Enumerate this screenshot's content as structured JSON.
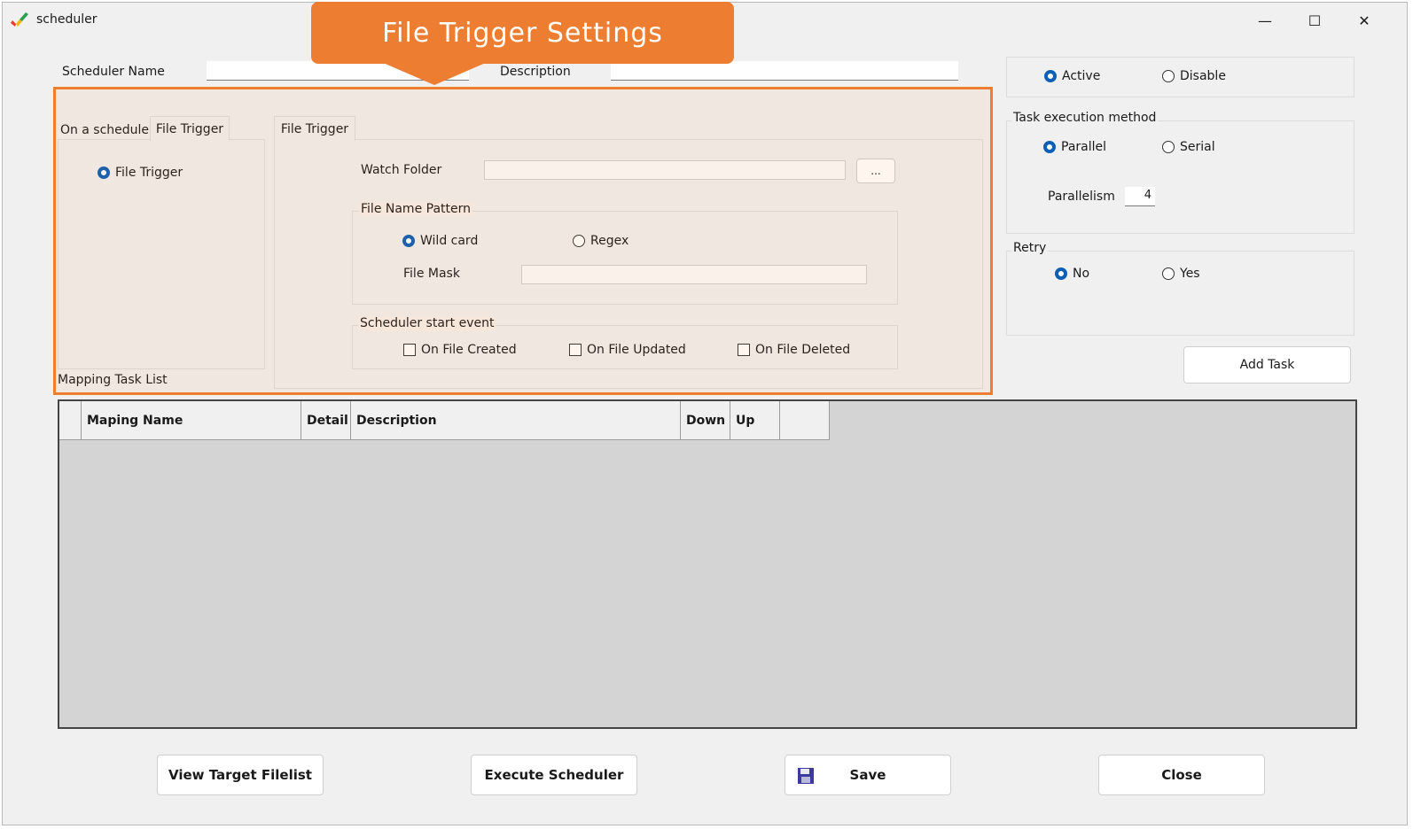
{
  "window": {
    "title": "scheduler",
    "controls": {
      "minimize": "—",
      "maximize": "☐",
      "close": "✕"
    }
  },
  "callout": {
    "text": "File Trigger Settings"
  },
  "header": {
    "scheduler_name_label": "Scheduler Name",
    "scheduler_name_value": "",
    "description_label": "Description",
    "description_value": ""
  },
  "status": {
    "options": [
      "Active",
      "Disable"
    ],
    "selected": "Active"
  },
  "task_execution": {
    "label": "Task execution method",
    "options": [
      "Parallel",
      "Serial"
    ],
    "selected": "Parallel",
    "parallelism_label": "Parallelism",
    "parallelism_value": "4"
  },
  "retry": {
    "label": "Retry",
    "options": [
      "No",
      "Yes"
    ],
    "selected": "No"
  },
  "left_tabs": {
    "tabs": [
      "On a schedule",
      "File Trigger"
    ],
    "active": "File Trigger",
    "radio_label": "File Trigger",
    "mapping_task_list_label": "Mapping Task List"
  },
  "file_trigger": {
    "tab_label": "File Trigger",
    "watch_folder_label": "Watch  Folder",
    "watch_folder_value": "",
    "browse_label": "...",
    "file_name_pattern": {
      "label": "File Name Pattern",
      "options": [
        "Wild card",
        "Regex"
      ],
      "selected": "Wild card",
      "file_mask_label": "File Mask",
      "file_mask_value": ""
    },
    "start_event": {
      "label": "Scheduler start event",
      "options": [
        "On File Created",
        "On File Updated",
        "On File Deleted"
      ]
    }
  },
  "add_task_label": "Add Task",
  "grid": {
    "columns": [
      "",
      "Maping Name",
      "Detail",
      "Description",
      "Down",
      "Up",
      ""
    ]
  },
  "footer": {
    "view_target_label": "View Target Filelist",
    "execute_label": "Execute Scheduler",
    "save_label": "Save",
    "close_label": "Close"
  }
}
